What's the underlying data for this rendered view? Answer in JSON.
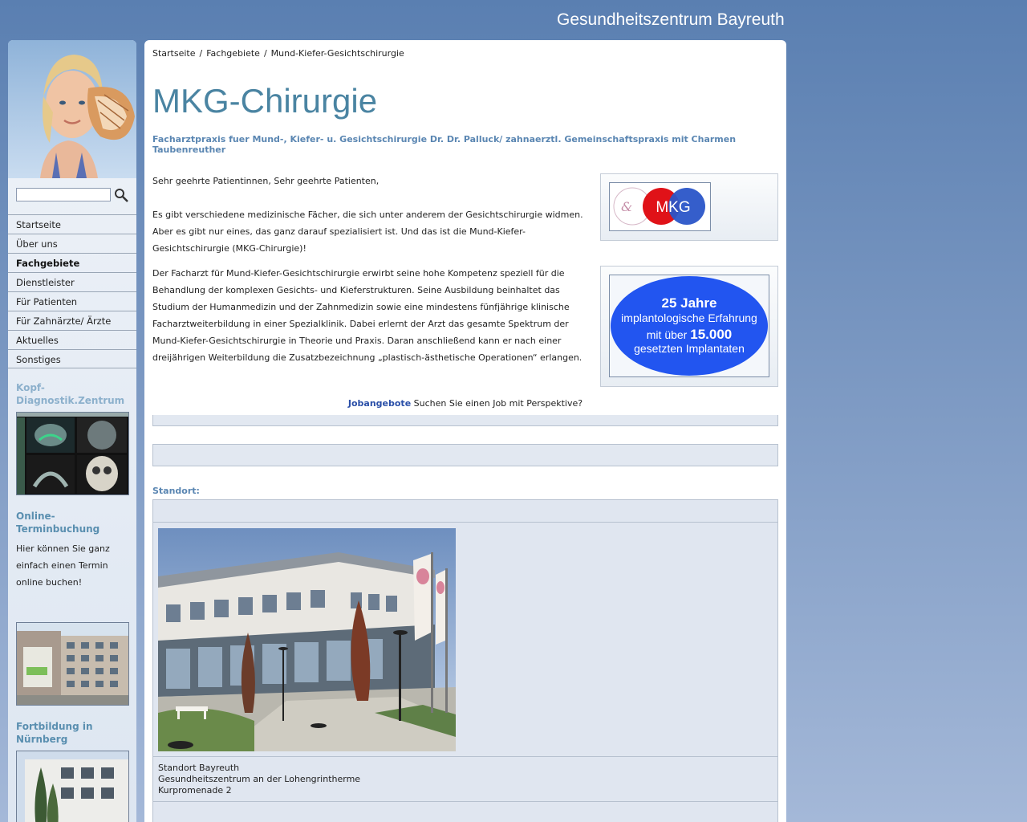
{
  "site_title": "Gesundheitszentrum Bayreuth",
  "sidebar": {
    "search": {
      "value": "",
      "placeholder": ""
    },
    "nav": [
      {
        "label": "Startseite",
        "active": false
      },
      {
        "label": "Über uns",
        "active": false
      },
      {
        "label": "Fachgebiete",
        "active": true
      },
      {
        "label": "Dienstleister",
        "active": false
      },
      {
        "label": "Für Patienten",
        "active": false
      },
      {
        "label": "Für Zahnärzte/ Ärzte",
        "active": false
      },
      {
        "label": "Aktuelles",
        "active": false
      },
      {
        "label": "Sonstiges",
        "active": false
      }
    ],
    "diagnostik_heading": "Kopf-Diagnostik.Zentrum",
    "online_heading": "Online-Terminbuchung",
    "online_text": "Hier können Sie ganz einfach einen Termin online buchen!",
    "fortbildung_heading": "Fortbildung in Nürnberg"
  },
  "breadcrumb": [
    "Startseite",
    "Fachgebiete",
    "Mund-Kiefer-Gesichtschirurgie"
  ],
  "main": {
    "title": "MKG-Chirurgie",
    "subtitle": "Facharztpraxis fuer Mund-, Kiefer- u. Gesichtschirurgie Dr. Dr. Palluck/ zahnaerztl. Gemeinschaftspraxis mit Charmen Taubenreuther",
    "greeting": "Sehr geehrte Patientinnen, Sehr geehrte Patienten,",
    "paragraph1": "Es gibt verschiedene medizinische Fächer, die sich unter anderem der Gesichtschirurgie widmen. Aber es gibt nur eines, das ganz darauf spezialisiert ist. Und das ist die Mund-Kiefer-Gesichtschirurgie (MKG-Chirurgie)!",
    "paragraph2": "Der Facharzt für Mund-Kiefer-Gesichtschirurgie erwirbt seine hohe Kompetenz speziell für die Behandlung der komplexen Gesichts- und Kieferstrukturen. Seine Ausbildung beinhaltet das Studium der Humanmedizin und der Zahnmedizin sowie eine mindestens fünfjährige klinische Facharztweiterbildung in einer Spezialklinik. Dabei erlernt der Arzt das gesamte Spektrum der Mund-Kiefer-Gesichtschirurgie in Theorie und Praxis. Daran anschließend kann er nach einer dreijährigen Weiterbildung die Zusatzbezeichnung „plastisch-ästhetische Operationen“ erlangen.",
    "logo_text": "MKG",
    "implant_banner": {
      "line1": "25 Jahre",
      "line2": "implantologische Erfahrung",
      "line3a": "mit über ",
      "line3b": "15.000",
      "line4": "gesetzten Implantaten"
    },
    "jobs_link": "Jobangebote",
    "jobs_text": " Suchen Sie einen Job mit Perspektive?",
    "standort_label": "Standort:",
    "location": {
      "line1": "Standort Bayreuth",
      "line2": "Gesundheitszentrum an der Lohengrintherme",
      "line3": "Kurpromenade 2"
    }
  }
}
